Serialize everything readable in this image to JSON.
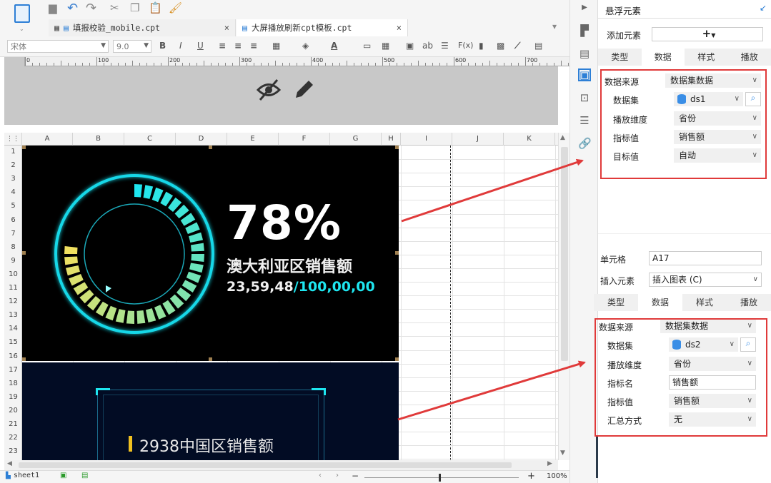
{
  "tabs": [
    {
      "label": "填报校验_mobile.cpt",
      "close": "×"
    },
    {
      "label": "大屏播放刷新cpt模板.cpt",
      "close": "×"
    }
  ],
  "format_bar": {
    "font_name": "宋体",
    "font_size": "9.0",
    "bold": "B",
    "italic": "I",
    "underline": "U",
    "text_color_glyph": "A",
    "text_glyph": "ab",
    "formula_glyph": "F(x)"
  },
  "ruler_labels": [
    "0",
    "100",
    "200",
    "300",
    "400",
    "500",
    "600",
    "700"
  ],
  "columns": [
    "A",
    "B",
    "C",
    "D",
    "E",
    "F",
    "G",
    "H",
    "I",
    "J",
    "K"
  ],
  "rows": [
    "1",
    "2",
    "3",
    "4",
    "5",
    "6",
    "7",
    "8",
    "9",
    "10",
    "11",
    "12",
    "13",
    "14",
    "15",
    "16",
    "17",
    "18",
    "19",
    "20",
    "21",
    "22",
    "23"
  ],
  "widget1": {
    "percent": "78%",
    "progress_fraction": 0.78,
    "title": "澳大利亚区销售额",
    "value_current": "23,59,48",
    "value_target": "/100,00,00"
  },
  "widget2": {
    "title": "2938中国区销售额"
  },
  "statusbar": {
    "sheet": "sheet1",
    "zoom": "100%",
    "minus": "−",
    "plus": "+"
  },
  "floating_panel": {
    "title": "悬浮元素",
    "add_label": "添加元素",
    "add_button": "+",
    "tabs": [
      "类型",
      "数据",
      "样式",
      "播放"
    ],
    "fields": [
      {
        "label": "数据来源",
        "value": "数据集数据"
      },
      {
        "label": "数据集",
        "value": "ds1"
      },
      {
        "label": "播放维度",
        "value": "省份"
      },
      {
        "label": "指标值",
        "value": "销售额"
      },
      {
        "label": "目标值",
        "value": "自动"
      }
    ]
  },
  "cell_panel": {
    "cell_label": "单元格",
    "cell_value": "A17",
    "insert_label": "插入元素",
    "insert_value": "插入图表 (C)",
    "tabs": [
      "类型",
      "数据",
      "样式",
      "播放"
    ],
    "fields": [
      {
        "label": "数据来源",
        "value": "数据集数据"
      },
      {
        "label": "数据集",
        "value": "ds2"
      },
      {
        "label": "播放维度",
        "value": "省份"
      },
      {
        "label": "指标名",
        "value": "销售额"
      },
      {
        "label": "指标值",
        "value": "销售额"
      },
      {
        "label": "汇总方式",
        "value": "无"
      }
    ]
  },
  "colors": {
    "annotation_red": "#e03a3a",
    "gauge_cyan": "#1ee6f0",
    "gauge_yellow": "#f0e060",
    "accent_blue": "#3a8ee6"
  }
}
